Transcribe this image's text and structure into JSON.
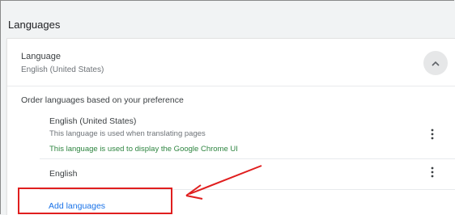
{
  "section": {
    "title": "Languages"
  },
  "language": {
    "label": "Language",
    "value": "English (United States)"
  },
  "order": {
    "label": "Order languages based on your preference",
    "languages": [
      {
        "name": "English (United States)",
        "note": "This language is used when translating pages",
        "note_green": "This language is used to display the Google Chrome UI"
      },
      {
        "name": "English"
      }
    ]
  },
  "actions": {
    "add_languages": "Add languages"
  },
  "colors": {
    "link": "#1a73e8",
    "ui_language_note": "#2e8540",
    "annotation": "#e01e1e"
  },
  "icons": {
    "collapse": "chevron-up-icon",
    "more": "more-vert-icon",
    "annotation_arrow": "arrow-icon"
  }
}
